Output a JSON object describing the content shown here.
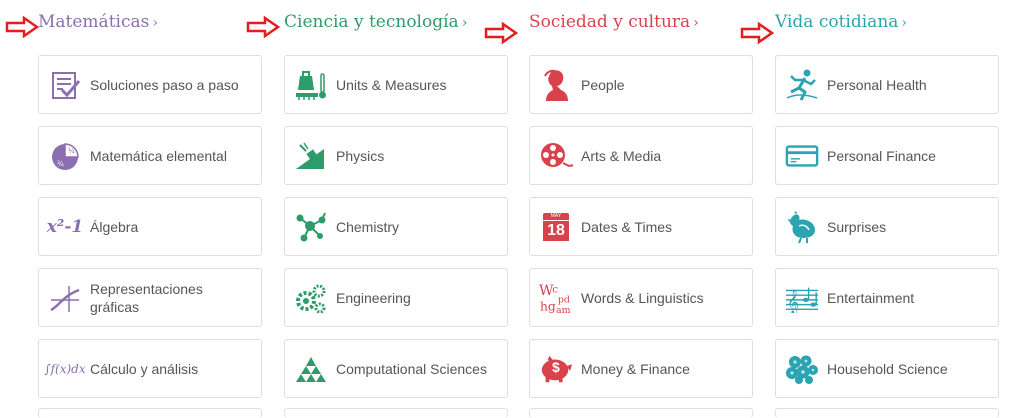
{
  "colors": {
    "purple": "#8a6fb1",
    "green": "#2e9c6a",
    "red": "#d9424b",
    "teal": "#2aa4b0",
    "arrow_red": "#e41e1e"
  },
  "columns": [
    {
      "heading": "Matemáticas",
      "chevron": "›",
      "items": [
        {
          "label": "Soluciones paso a paso",
          "icon": "checklist-icon"
        },
        {
          "label": "Matemática elemental",
          "icon": "fraction-pie-icon"
        },
        {
          "label": "Álgebra",
          "icon": "algebra-icon",
          "icon_text": "x²-1"
        },
        {
          "label": "Representaciones gráficas",
          "icon": "graph-icon"
        },
        {
          "label": "Cálculo y análisis",
          "icon": "integral-icon",
          "icon_text": "∫f(x)dx"
        }
      ]
    },
    {
      "heading": "Ciencia y tecnología",
      "chevron": "›",
      "items": [
        {
          "label": "Units & Measures",
          "icon": "scale-thermometer-icon"
        },
        {
          "label": "Physics",
          "icon": "physics-ramp-icon"
        },
        {
          "label": "Chemistry",
          "icon": "molecule-icon"
        },
        {
          "label": "Engineering",
          "icon": "gears-icon"
        },
        {
          "label": "Computational Sciences",
          "icon": "sierpinski-icon"
        }
      ]
    },
    {
      "heading": "Sociedad y cultura",
      "chevron": "›",
      "items": [
        {
          "label": "People",
          "icon": "person-bust-icon"
        },
        {
          "label": "Arts & Media",
          "icon": "film-reel-icon"
        },
        {
          "label": "Dates & Times",
          "icon": "calendar-icon",
          "icon_text": "18",
          "icon_small": "MAY"
        },
        {
          "label": "Words & Linguistics",
          "icon": "letters-icon",
          "icon_text": "Wc hg pd am"
        },
        {
          "label": "Money & Finance",
          "icon": "piggy-bank-icon",
          "icon_text": "$"
        }
      ]
    },
    {
      "heading": "Vida cotidiana",
      "chevron": "›",
      "items": [
        {
          "label": "Personal Health",
          "icon": "runner-icon"
        },
        {
          "label": "Personal Finance",
          "icon": "credit-card-icon"
        },
        {
          "label": "Surprises",
          "icon": "chicken-icon"
        },
        {
          "label": "Entertainment",
          "icon": "music-staff-icon"
        },
        {
          "label": "Household Science",
          "icon": "cells-icon"
        }
      ]
    }
  ]
}
